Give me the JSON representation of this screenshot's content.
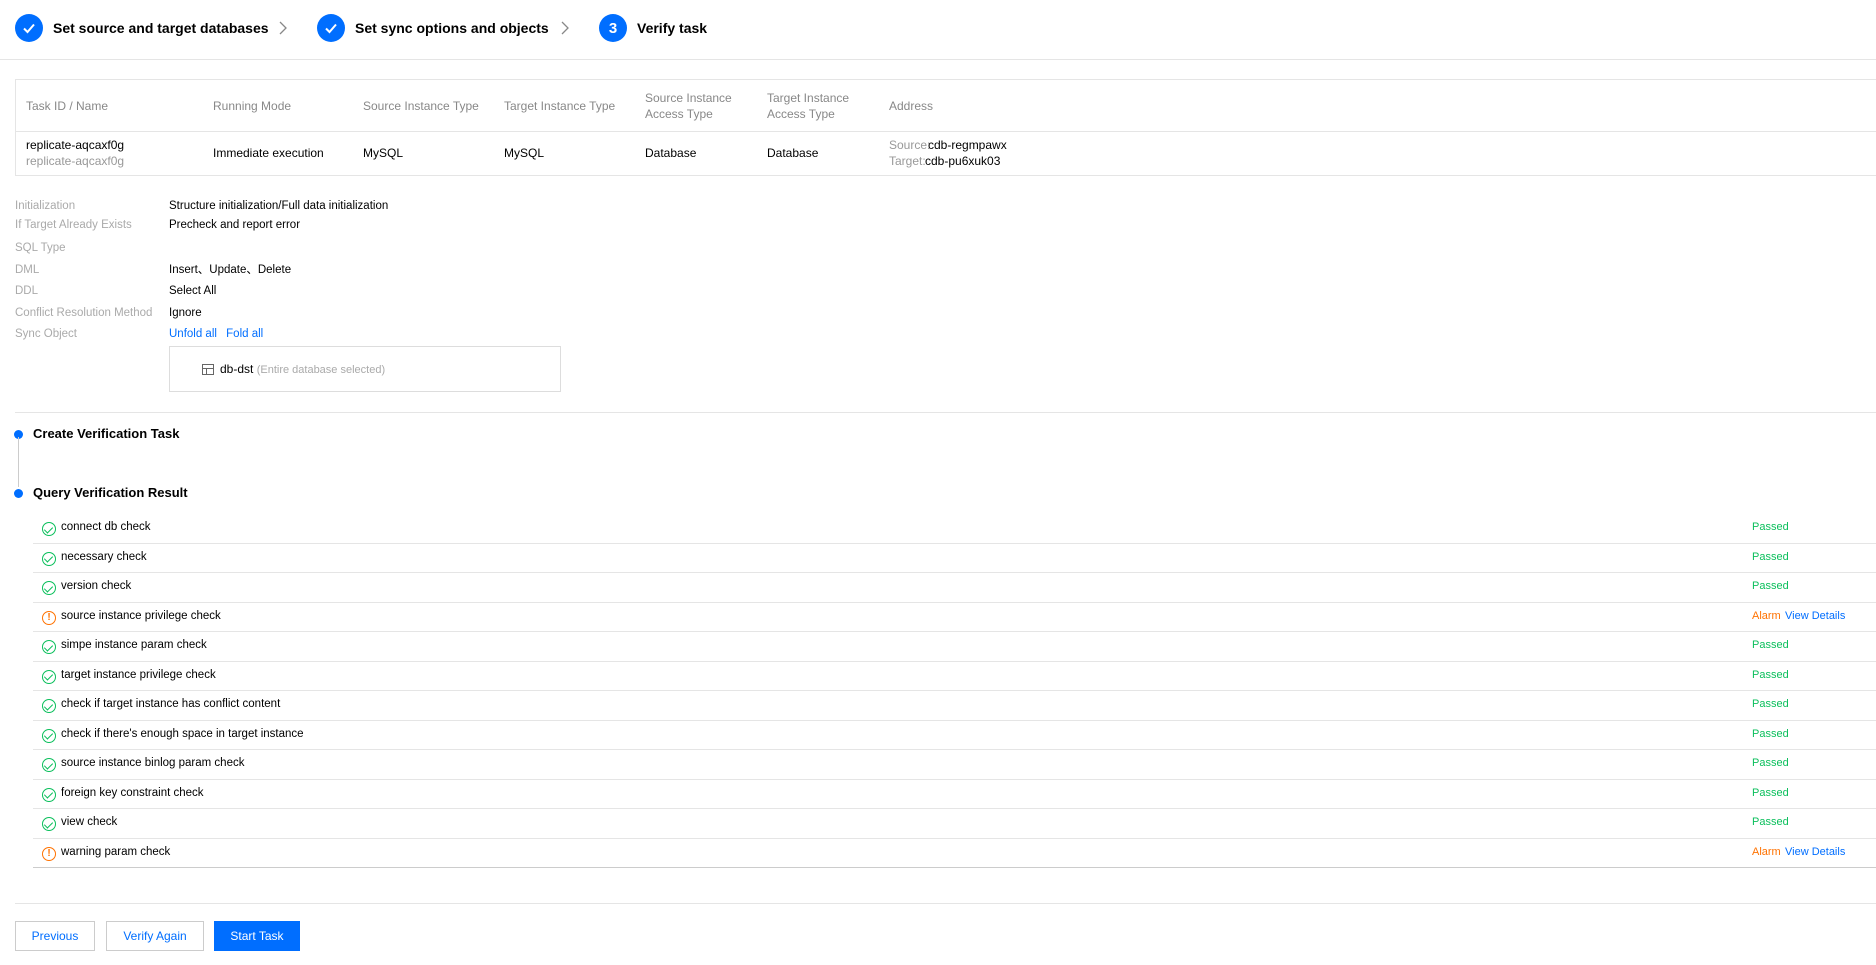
{
  "steps": [
    {
      "number": "",
      "label": "Set source and target databases",
      "state": "done"
    },
    {
      "number": "",
      "label": "Set sync options and objects",
      "state": "done"
    },
    {
      "number": "3",
      "label": "Verify task",
      "state": "current"
    }
  ],
  "task_table": {
    "headers": [
      "Task ID / Name",
      "Running Mode",
      "Source Instance Type",
      "Target Instance Type",
      "Source Instance\nAccess Type",
      "Target Instance\nAccess Type",
      "Address"
    ],
    "header_source_access": [
      "Source Instance",
      "Access Type"
    ],
    "header_target_access": [
      "Target Instance",
      "Access Type"
    ],
    "row": {
      "task_id": "replicate-aqcaxf0g",
      "task_name": "replicate-aqcaxf0g",
      "running_mode": "Immediate execution",
      "source_type": "MySQL",
      "target_type": "MySQL",
      "source_access": "Database",
      "target_access": "Database",
      "source_label": "Source:",
      "source_addr": "cdb-regmpawx",
      "target_label": "Target:",
      "target_addr": "cdb-pu6xuk03"
    }
  },
  "details": {
    "initialization_label": "Initialization",
    "initialization_value": "Structure initialization/Full data initialization",
    "if_exists_label": "If Target Already Exists",
    "if_exists_value": "Precheck and report error",
    "sql_type_label": "SQL Type",
    "dml_label": "DML",
    "dml_value": "Insert、Update、Delete",
    "ddl_label": "DDL",
    "ddl_value": "Select All",
    "conflict_label": "Conflict Resolution Method",
    "conflict_value": "Ignore",
    "sync_object_label": "Sync Object",
    "unfold_all": "Unfold all",
    "fold_all": "Fold all",
    "db_name": "db-dst",
    "db_note": "(Entire database selected)"
  },
  "timeline": {
    "create_title": "Create Verification Task",
    "query_title": "Query Verification Result"
  },
  "checks": [
    {
      "name": "connect db check",
      "status": "Passed",
      "type": "pass"
    },
    {
      "name": "necessary check",
      "status": "Passed",
      "type": "pass"
    },
    {
      "name": "version check",
      "status": "Passed",
      "type": "pass"
    },
    {
      "name": "source instance privilege check",
      "status": "Alarm",
      "type": "alarm",
      "details": "View Details"
    },
    {
      "name": "simpe instance param check",
      "status": "Passed",
      "type": "pass"
    },
    {
      "name": "target instance privilege check",
      "status": "Passed",
      "type": "pass"
    },
    {
      "name": "check if target instance has conflict content",
      "status": "Passed",
      "type": "pass"
    },
    {
      "name": "check if there's enough space in target instance",
      "status": "Passed",
      "type": "pass"
    },
    {
      "name": "source instance binlog param check",
      "status": "Passed",
      "type": "pass"
    },
    {
      "name": "foreign key constraint check",
      "status": "Passed",
      "type": "pass"
    },
    {
      "name": "view check",
      "status": "Passed",
      "type": "pass"
    },
    {
      "name": "warning param check",
      "status": "Alarm",
      "type": "alarm",
      "details": "View Details"
    }
  ],
  "buttons": {
    "previous": "Previous",
    "verify_again": "Verify Again",
    "start_task": "Start Task"
  },
  "colors": {
    "primary": "#006eff",
    "passed": "#0abf5b",
    "alarm": "#ff7200"
  }
}
